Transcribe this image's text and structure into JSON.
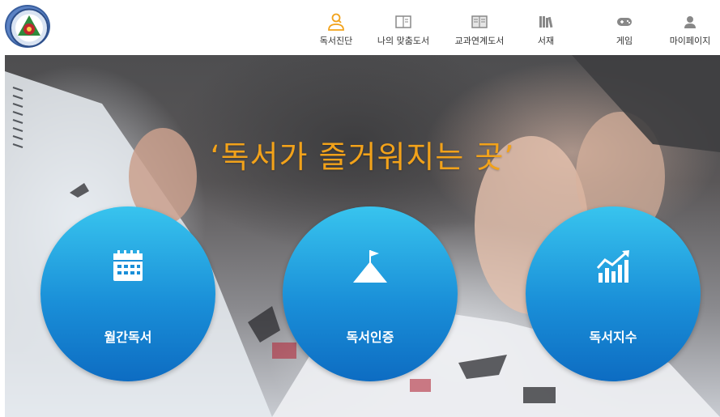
{
  "header": {
    "logo_icon": "school-emblem-logo",
    "nav": [
      {
        "label": "독서진단",
        "icon": "search-person-icon",
        "color": "#f2a21a"
      },
      {
        "label": "나의 맞춤도서",
        "icon": "open-book-icon",
        "color": "#888888"
      },
      {
        "label": "교과연계도서",
        "icon": "book-icon",
        "color": "#888888"
      },
      {
        "label": "서재",
        "icon": "bookshelf-icon",
        "color": "#888888"
      },
      {
        "label": "게임",
        "icon": "gamepad-icon",
        "color": "#888888"
      },
      {
        "label": "마이페이지",
        "icon": "user-icon",
        "color": "#888888"
      }
    ]
  },
  "hero": {
    "slogan": "‘독서가 즐거워지는 곳’",
    "slogan_color": "#f2a21a",
    "circles": [
      {
        "label": "월간독서",
        "icon": "calendar-icon"
      },
      {
        "label": "독서인증",
        "icon": "mountain-flag-icon"
      },
      {
        "label": "독서지수",
        "icon": "growth-chart-icon"
      }
    ],
    "circle_color": "#1a8fd8"
  }
}
